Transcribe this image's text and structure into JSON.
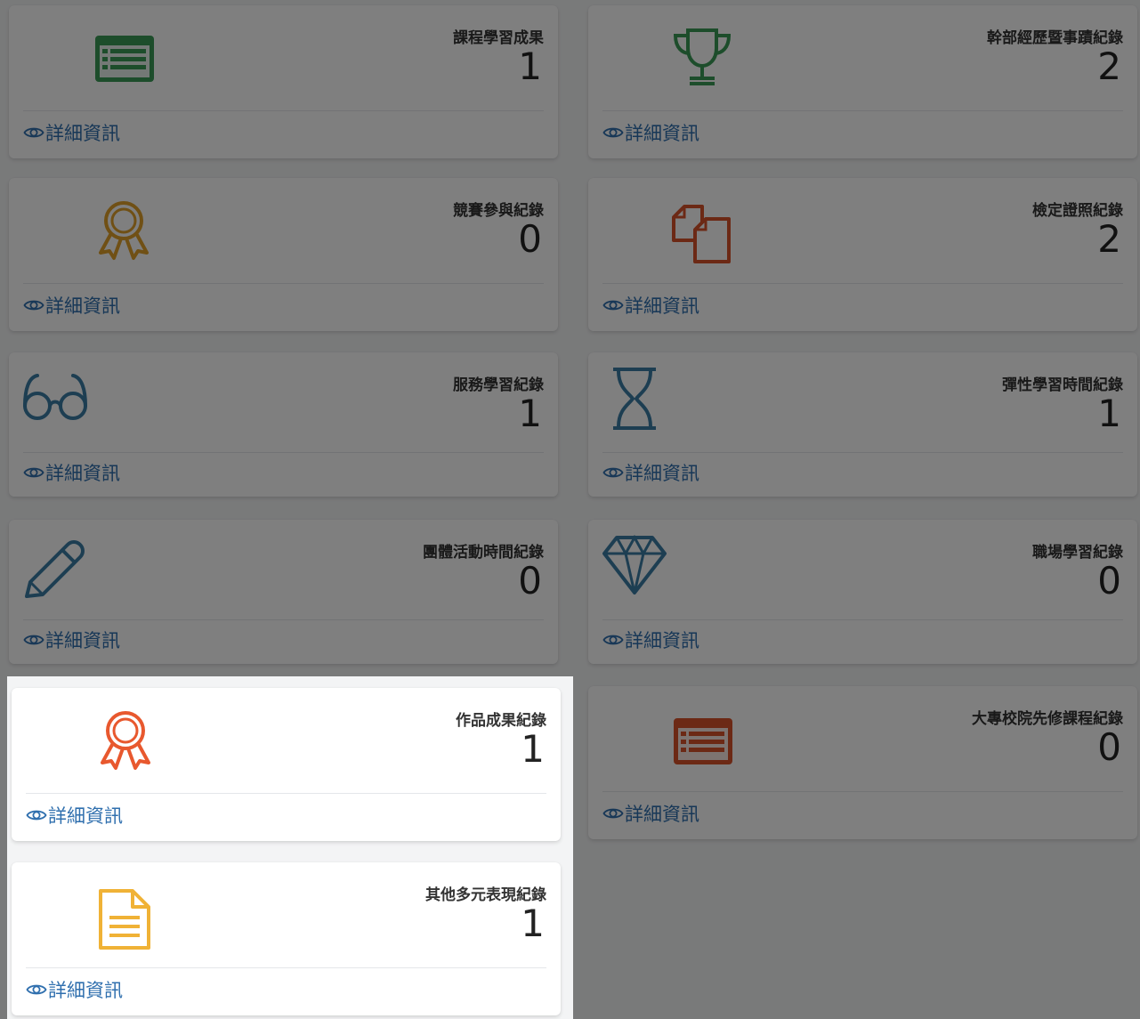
{
  "detail_label": "詳細資訊",
  "cards": [
    {
      "id": "course",
      "title": "課程學習成果",
      "count": "1",
      "icon": "table-list-icon",
      "color": "#3a9a56"
    },
    {
      "id": "cadre",
      "title": "幹部經歷暨事蹟紀錄",
      "count": "2",
      "icon": "trophy-icon",
      "color": "#3a9a56"
    },
    {
      "id": "competition",
      "title": "競賽參與紀錄",
      "count": "0",
      "icon": "award-ribbon-icon",
      "color": "#e0a02b"
    },
    {
      "id": "certificate",
      "title": "檢定證照紀錄",
      "count": "2",
      "icon": "copy-files-icon",
      "color": "#d9522b"
    },
    {
      "id": "service",
      "title": "服務學習紀錄",
      "count": "1",
      "icon": "glasses-icon",
      "color": "#3a7ca5"
    },
    {
      "id": "flexible",
      "title": "彈性學習時間紀錄",
      "count": "1",
      "icon": "hourglass-icon",
      "color": "#3a7ca5"
    },
    {
      "id": "group",
      "title": "團體活動時間紀錄",
      "count": "0",
      "icon": "pencil-icon",
      "color": "#3a7ca5"
    },
    {
      "id": "workplace",
      "title": "職場學習紀錄",
      "count": "0",
      "icon": "diamond-icon",
      "color": "#3a7ca5"
    },
    {
      "id": "works",
      "title": "作品成果紀錄",
      "count": "1",
      "icon": "award-ribbon-icon",
      "color": "#e8582e"
    },
    {
      "id": "college",
      "title": "大專校院先修課程紀錄",
      "count": "0",
      "icon": "table-list-icon",
      "color": "#d9522b"
    },
    {
      "id": "other",
      "title": "其他多元表現紀錄",
      "count": "1",
      "icon": "document-icon",
      "color": "#f0b236"
    }
  ]
}
